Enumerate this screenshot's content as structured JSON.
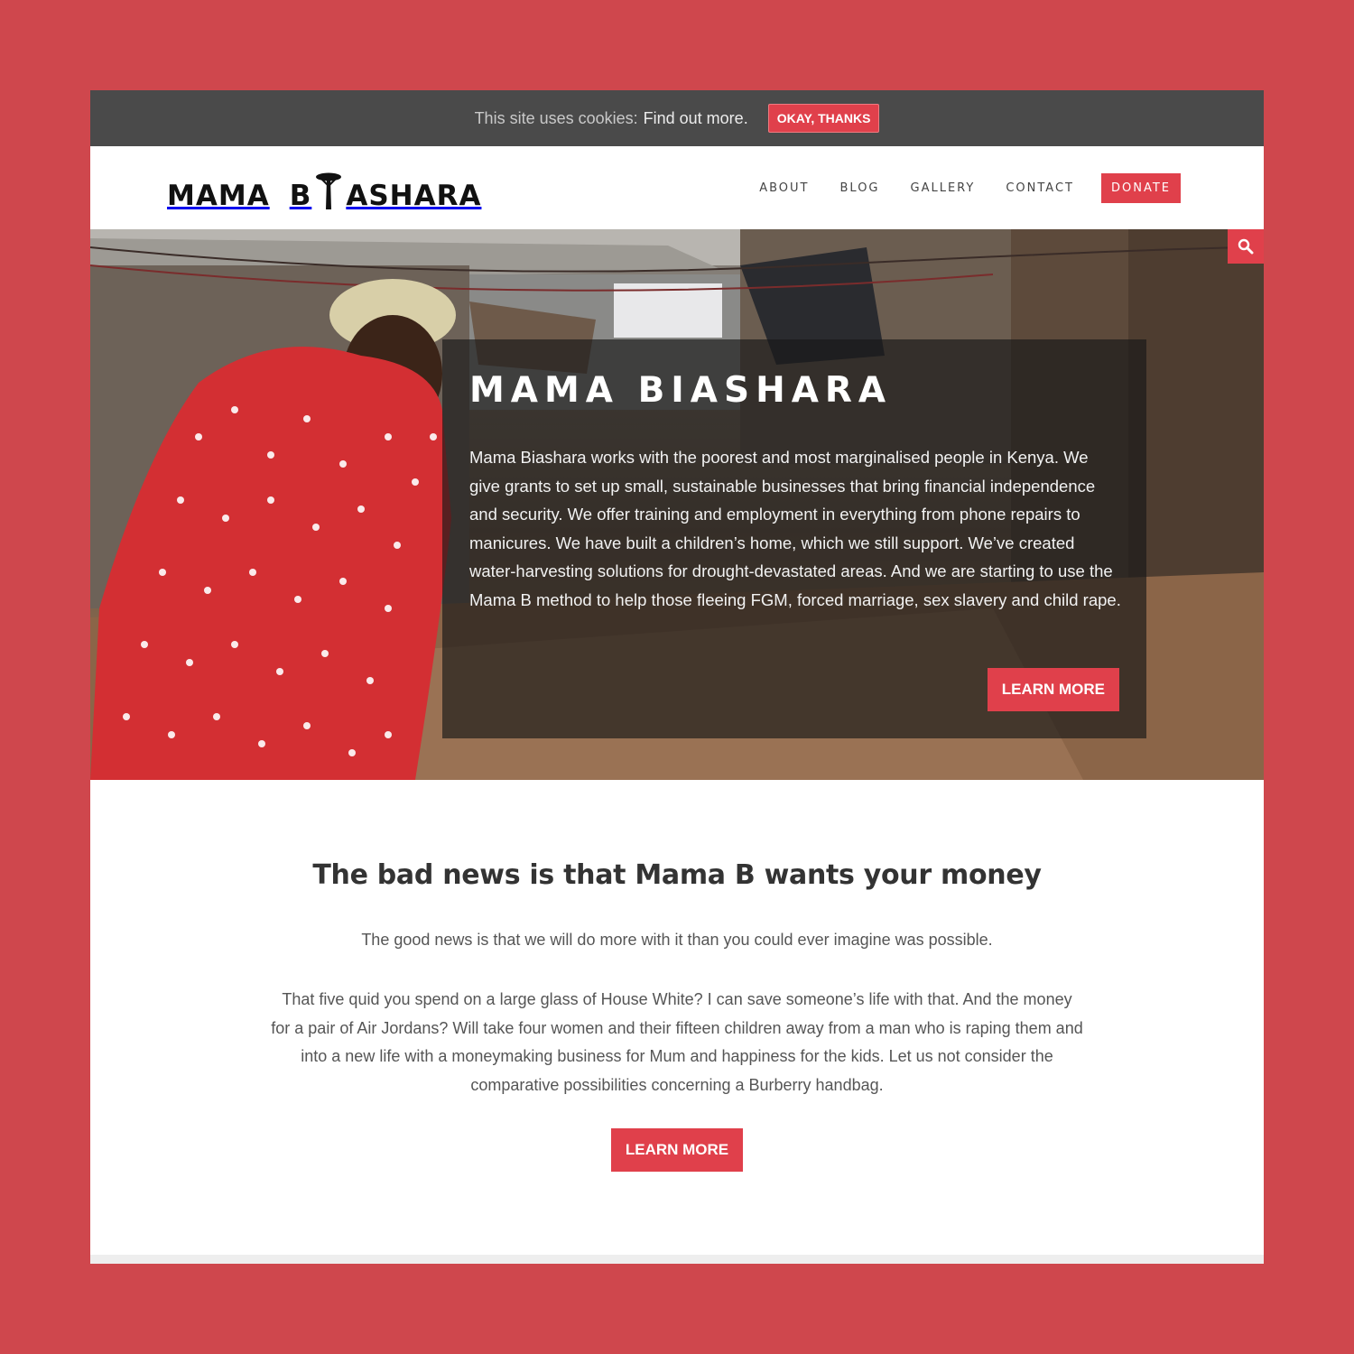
{
  "cookie_bar": {
    "text": "This site uses cookies:",
    "link": "Find out more.",
    "button": "OKAY, THANKS"
  },
  "header": {
    "logo_left": "MAMA",
    "logo_right_a": "B",
    "logo_right_b": "ASHARA",
    "nav": [
      "ABOUT",
      "BLOG",
      "GALLERY",
      "CONTACT"
    ],
    "donate": "DONATE"
  },
  "hero": {
    "title": "MAMA BIASHARA",
    "text": "Mama Biashara works with the poorest and most marginalised people in Kenya. We give grants to set up small, sustainable businesses that bring financial independence and security. We offer training and employment in everything from phone repairs to manicures. We have built a children’s home, which we still support. We’ve created water-harvesting solutions for drought-devastated areas. And we are starting to use the Mama B method to help those fleeing FGM, forced marriage, sex slavery and child rape.",
    "button": "LEARN MORE"
  },
  "section": {
    "title": "The bad news is that Mama B wants your money",
    "lead": "The good news is that we will do more with it than you could ever imagine was possible.",
    "paragraph": "That five quid you spend on a large glass of House White? I can save someone’s life with that. And the money for a pair of Air Jordans? Will take four women and their fifteen children away from a man who is raping them and into a new life with a moneymaking business for Mum and happiness for the kids. Let us not consider the comparative possibilities concerning a Burberry handbag.",
    "button": "LEARN MORE"
  },
  "colors": {
    "frame": "#cf474d",
    "accent": "#e0404b",
    "cookie_bar": "#4a4a4a"
  },
  "icons": [
    "search-icon",
    "acacia-tree-icon"
  ]
}
